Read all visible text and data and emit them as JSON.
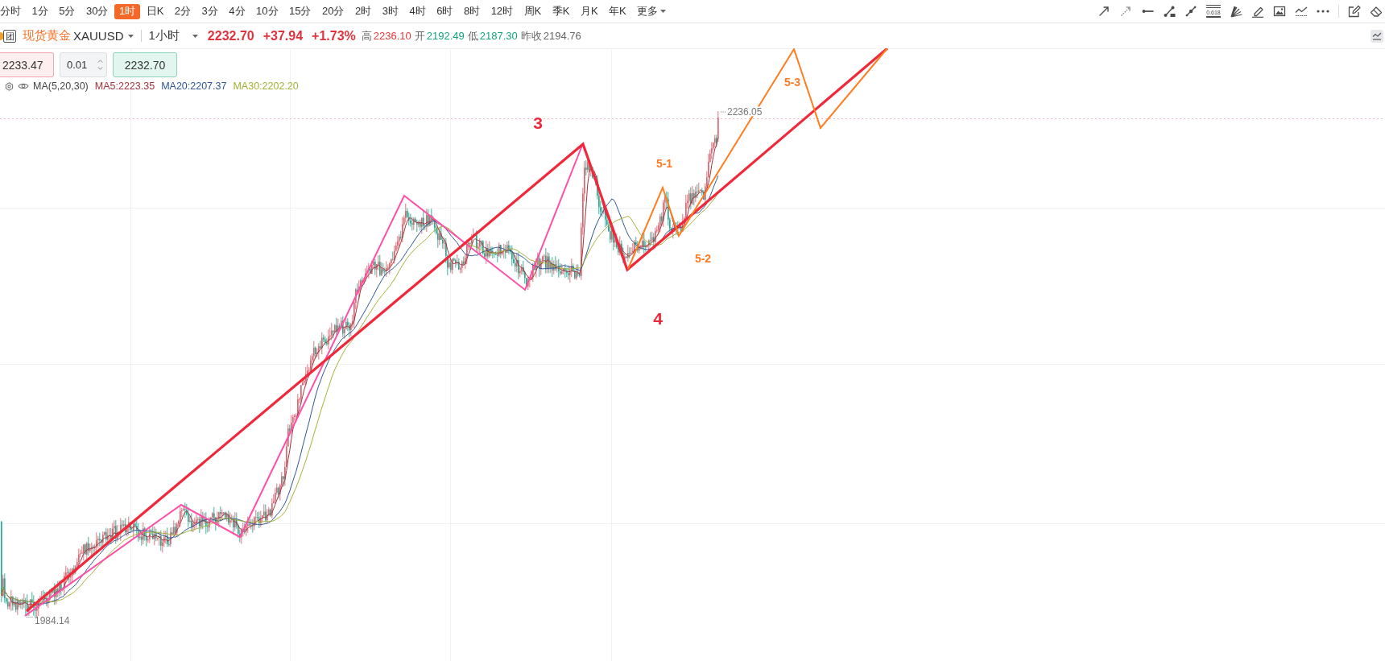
{
  "timeframes": [
    {
      "label": "分时",
      "selected": false
    },
    {
      "label": "1分",
      "selected": false
    },
    {
      "label": "5分",
      "selected": false
    },
    {
      "label": "30分",
      "selected": false
    },
    {
      "label": "1时",
      "selected": true
    },
    {
      "label": "日K",
      "selected": false
    },
    {
      "label": "2分",
      "selected": false
    },
    {
      "label": "3分",
      "selected": false
    },
    {
      "label": "4分",
      "selected": false
    },
    {
      "label": "10分",
      "selected": false
    },
    {
      "label": "15分",
      "selected": false
    },
    {
      "label": "20分",
      "selected": false
    },
    {
      "label": "2时",
      "selected": false
    },
    {
      "label": "3时",
      "selected": false
    },
    {
      "label": "4时",
      "selected": false
    },
    {
      "label": "6时",
      "selected": false
    },
    {
      "label": "8时",
      "selected": false
    },
    {
      "label": "12时",
      "selected": false
    },
    {
      "label": "周K",
      "selected": false
    },
    {
      "label": "季K",
      "selected": false
    },
    {
      "label": "月K",
      "selected": false
    },
    {
      "label": "年K",
      "selected": false
    }
  ],
  "more_menu": {
    "label": "更多"
  },
  "drawing_tools": {
    "fibonacci_label": "0.618"
  },
  "symbol": {
    "badge": "团",
    "name": "现货黄金",
    "code": "XAUUSD",
    "interval": "1小时",
    "price": "2232.70",
    "change": "+37.94",
    "change_percent": "+1.73%",
    "stats": [
      {
        "label": "高",
        "value": "2236.10",
        "color": "#e4393c"
      },
      {
        "label": "开",
        "value": "2192.49",
        "color": "#14a47c"
      },
      {
        "label": "低",
        "value": "2187.30",
        "color": "#14a47c"
      },
      {
        "label": "昨收",
        "value": "2194.76",
        "color": "#666666"
      }
    ]
  },
  "order": {
    "sell_price": "2233.47",
    "quantity": "0.01",
    "buy_price": "2232.70"
  },
  "indicator": {
    "name": "MA(5,20,30)",
    "values": [
      {
        "label": "MA5:2223.35",
        "color": "#a3343d"
      },
      {
        "label": "MA20:2207.37",
        "color": "#2b5597"
      },
      {
        "label": "MA30:2202.20",
        "color": "#a4b035"
      }
    ]
  },
  "chart": {
    "high_label": "2236.05",
    "low_label": "1984.14",
    "wave_labels": [
      {
        "text": "3",
        "kind": "wave",
        "color": "#f0283c"
      },
      {
        "text": "4",
        "kind": "wave",
        "color": "#f0283c"
      },
      {
        "text": "5-1",
        "kind": "subwave",
        "color": "#ff7a22"
      },
      {
        "text": "5-2",
        "kind": "subwave",
        "color": "#ff7a22"
      },
      {
        "text": "5-3",
        "kind": "subwave",
        "color": "#ff7a22"
      }
    ]
  }
}
